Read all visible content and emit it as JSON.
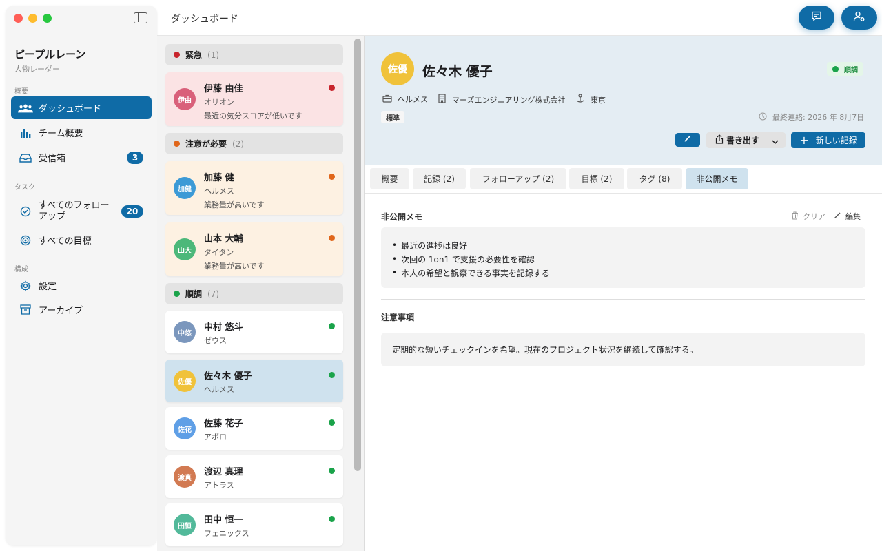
{
  "window": {
    "title": "ダッシュボード"
  },
  "sidebar": {
    "app_title": "ピープルレーン",
    "app_subtitle": "人物レーダー",
    "sections": {
      "overview": "概要",
      "tasks": "タスク",
      "config": "構成"
    },
    "items": [
      {
        "label": "ダッシュボード",
        "icon": "people-icon",
        "active": true
      },
      {
        "label": "チーム概要",
        "icon": "bar-chart-icon"
      },
      {
        "label": "受信箱",
        "icon": "inbox-icon",
        "badge": "3"
      },
      {
        "label": "すべてのフォローアップ",
        "icon": "check-circle-icon",
        "badge": "20"
      },
      {
        "label": "すべての目標",
        "icon": "target-icon"
      },
      {
        "label": "設定",
        "icon": "gear-icon"
      },
      {
        "label": "アーカイブ",
        "icon": "archive-icon"
      }
    ]
  },
  "groups": {
    "urgent": {
      "label": "緊急",
      "count": "(1)",
      "color": "#c8242c"
    },
    "attention": {
      "label": "注意が必要",
      "count": "(2)",
      "color": "#e0661b"
    },
    "good": {
      "label": "順調",
      "count": "(7)",
      "color": "#1aa34a"
    }
  },
  "people": [
    {
      "initials": "伊由",
      "name": "伊藤 由佳",
      "team": "オリオン",
      "note": "最近の気分スコアが低いです",
      "avatar_color": "#d9607a",
      "status_color": "#c8242c"
    },
    {
      "initials": "加健",
      "name": "加藤 健",
      "team": "ヘルメス",
      "note": "業務量が高いです",
      "avatar_color": "#3c9ad6",
      "status_color": "#e0661b"
    },
    {
      "initials": "山大",
      "name": "山本 大輔",
      "team": "タイタン",
      "note": "業務量が高いです",
      "avatar_color": "#4cb87a",
      "status_color": "#e0661b"
    },
    {
      "initials": "中悠",
      "name": "中村 悠斗",
      "team": "ゼウス",
      "avatar_color": "#7b97bd",
      "status_color": "#1aa34a"
    },
    {
      "initials": "佐優",
      "name": "佐々木 優子",
      "team": "ヘルメス",
      "avatar_color": "#f0c23a",
      "status_color": "#1aa34a"
    },
    {
      "initials": "佐花",
      "name": "佐藤 花子",
      "team": "アポロ",
      "avatar_color": "#5f9fe6",
      "status_color": "#1aa34a"
    },
    {
      "initials": "渡真",
      "name": "渡辺 真理",
      "team": "アトラス",
      "avatar_color": "#d27a52",
      "status_color": "#1aa34a"
    },
    {
      "initials": "田恒",
      "name": "田中 恒一",
      "team": "フェニックス",
      "avatar_color": "#52b99a",
      "status_color": "#1aa34a"
    }
  ],
  "detail": {
    "initials": "佐優",
    "name": "佐々木 優子",
    "status": "順調",
    "team": "ヘルメス",
    "company": "マーズエンジニアリング株式会社",
    "location": "東京",
    "level": "標準",
    "last_contact": "最終連絡: 2026 年 8月7日",
    "export_label": "書き出す",
    "new_record_label": "新しい記録",
    "tabs": [
      "概要",
      "記録 (2)",
      "フォローアップ (2)",
      "目標 (2)",
      "タグ (8)",
      "非公開メモ"
    ],
    "private_memo_title": "非公開メモ",
    "clear_label": "クリア",
    "edit_label": "編集",
    "memo_lines": [
      "最近の進捗は良好",
      "次回の 1on1 で支援の必要性を確認",
      "本人の希望と観察できる事実を記録する"
    ],
    "notes_title": "注意事項",
    "notes_text": "定期的な短いチェックインを希望。現在のプロジェクト状況を継続して確認する。"
  }
}
